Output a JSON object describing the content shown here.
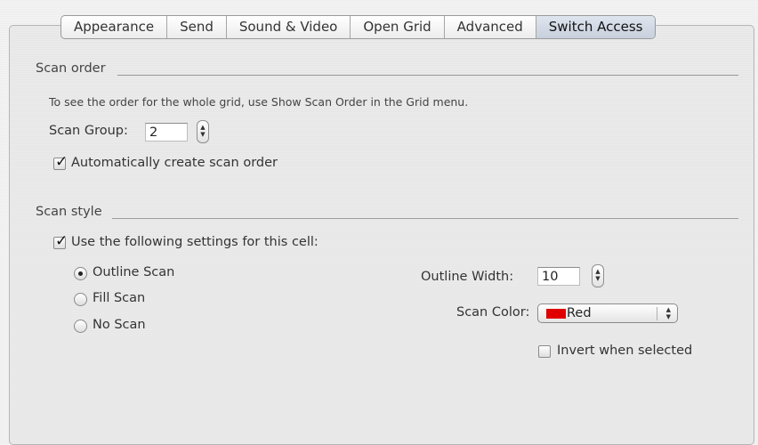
{
  "tabs": [
    {
      "label": "Appearance",
      "selected": false
    },
    {
      "label": "Send",
      "selected": false
    },
    {
      "label": "Sound & Video",
      "selected": false
    },
    {
      "label": "Open Grid",
      "selected": false
    },
    {
      "label": "Advanced",
      "selected": false
    },
    {
      "label": "Switch Access",
      "selected": true
    }
  ],
  "scan_order": {
    "heading": "Scan order",
    "hint": "To see the order for the whole grid, use Show Scan Order in the Grid menu.",
    "scan_group_label": "Scan Group:",
    "scan_group_value": "2",
    "auto_create_label": "Automatically create scan order",
    "auto_create_checked": true
  },
  "scan_style": {
    "heading": "Scan style",
    "use_settings_label": "Use the following settings for this cell:",
    "use_settings_checked": true,
    "options": [
      {
        "label": "Outline Scan",
        "selected": true
      },
      {
        "label": "Fill Scan",
        "selected": false
      },
      {
        "label": "No Scan",
        "selected": false
      }
    ],
    "outline_width_label": "Outline Width:",
    "outline_width_value": "10",
    "scan_color_label": "Scan Color:",
    "scan_color_value": "Red",
    "scan_color_hex": "#e00000",
    "invert_label": "Invert when selected",
    "invert_checked": false
  }
}
